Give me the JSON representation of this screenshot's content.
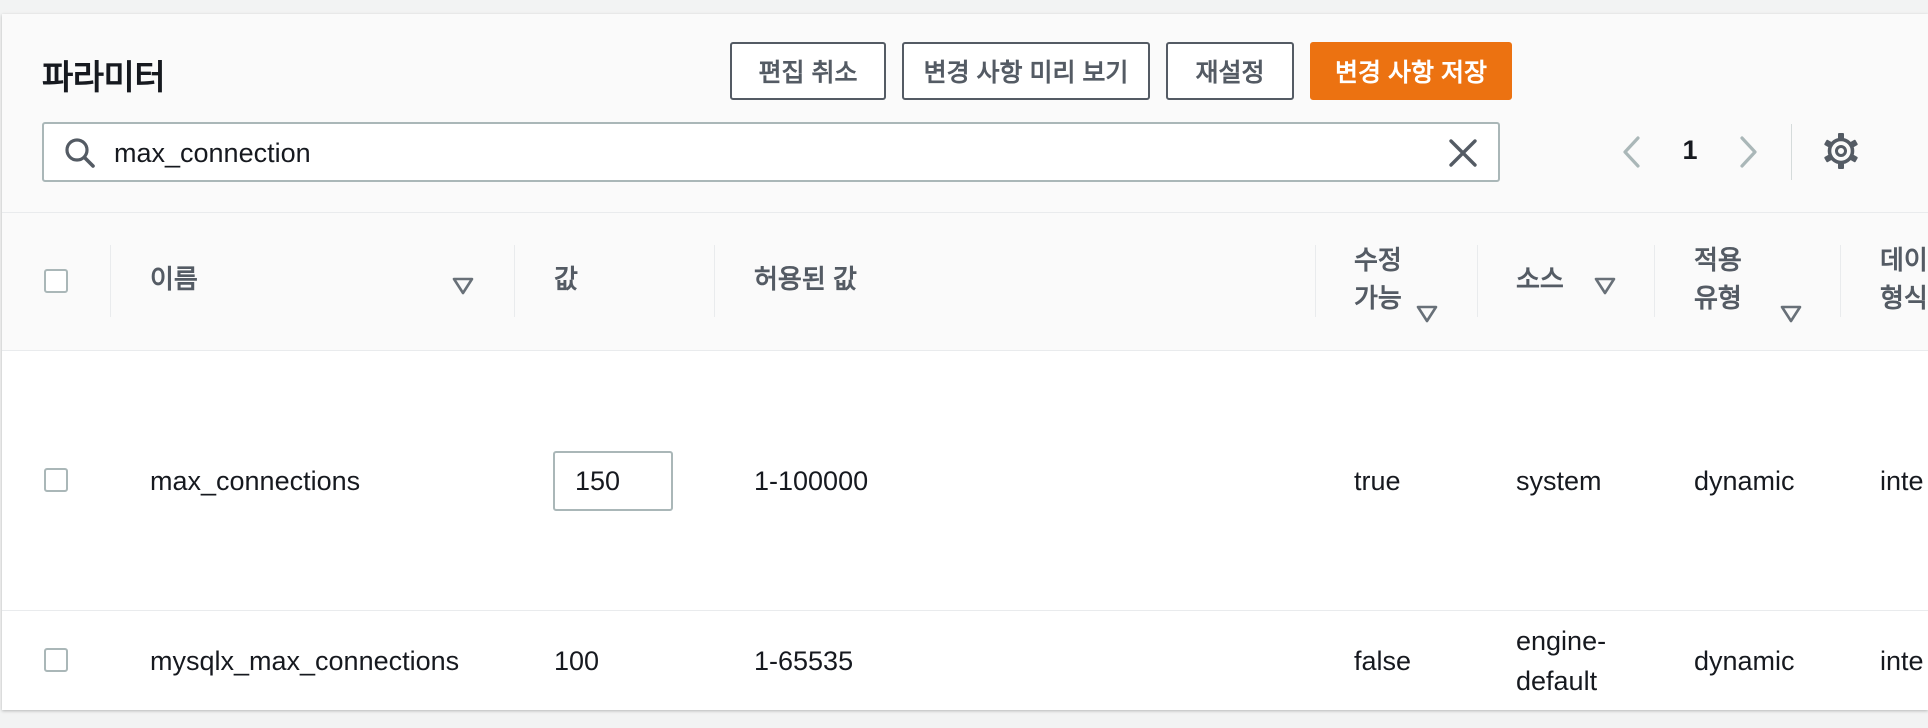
{
  "header": {
    "title": "파라미터",
    "buttons": {
      "cancel_edit": "편집 취소",
      "preview_changes": "변경 사항 미리 보기",
      "reset": "재설정",
      "save_changes": "변경 사항 저장"
    },
    "search": {
      "value": "max_connection",
      "icon": "search-icon",
      "clear_icon": "close-icon"
    },
    "pagination": {
      "current_page": "1",
      "prev_icon": "chevron-left-icon",
      "next_icon": "chevron-right-icon"
    },
    "settings_icon": "gear-icon"
  },
  "table": {
    "columns": {
      "name": "이름",
      "value": "값",
      "allowed_values": "허용된 값",
      "modifiable": [
        "수정",
        "가능"
      ],
      "source": "소스",
      "apply_type": [
        "적용",
        "유형"
      ],
      "data_type": [
        "데이",
        "형식"
      ]
    },
    "rows": [
      {
        "name": "max_connections",
        "value": "150",
        "allowed_values": "1-100000",
        "modifiable": "true",
        "source": "system",
        "apply_type": "dynamic",
        "data_type": "inte"
      },
      {
        "name": "mysqlx_max_connections",
        "value": "100",
        "allowed_values": "1-65535",
        "modifiable": "false",
        "source": [
          "engine-",
          "default"
        ],
        "apply_type": "dynamic",
        "data_type": "inte"
      }
    ]
  },
  "colors": {
    "primary": "#ec7211",
    "border": "#aab7b8",
    "text": "#16191f",
    "muted": "#545b64"
  }
}
